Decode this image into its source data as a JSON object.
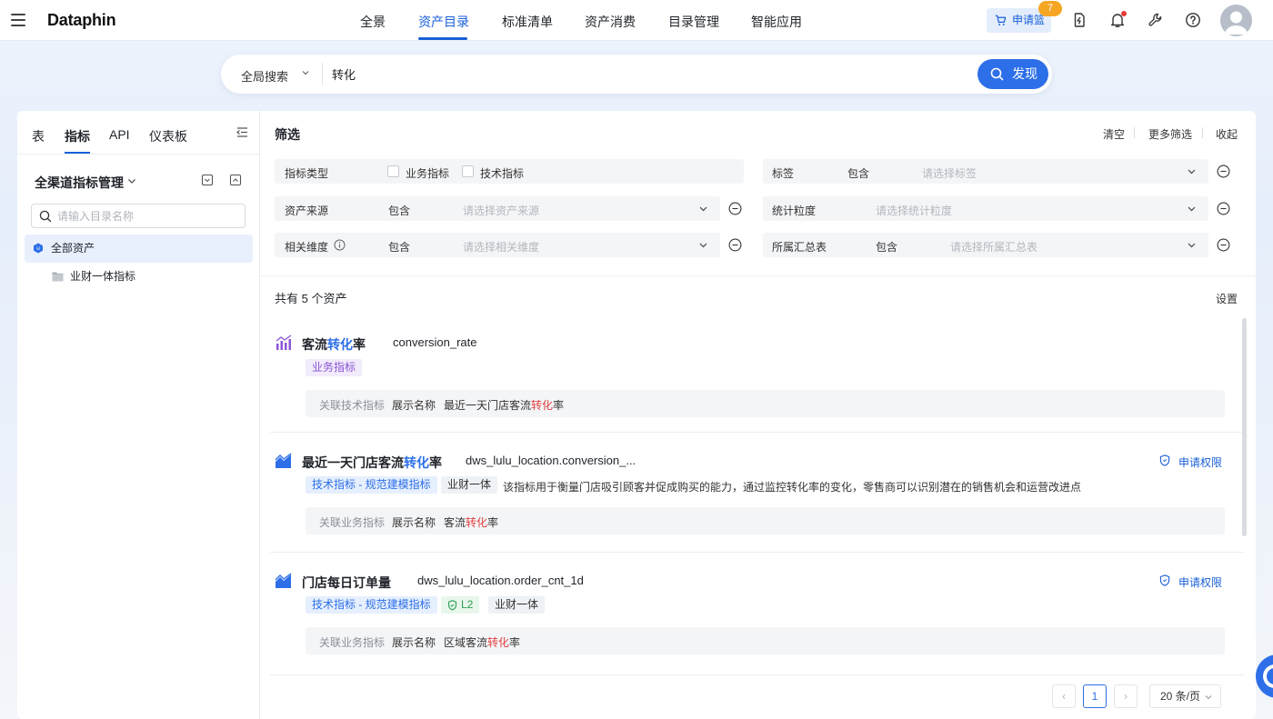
{
  "app": {
    "logo": "Dataphin"
  },
  "nav": {
    "items": [
      "全景",
      "资产目录",
      "标准清单",
      "资产消费",
      "目录管理",
      "智能应用"
    ],
    "active_index": 1
  },
  "header": {
    "cart_label": "申请篮",
    "cart_count": "7"
  },
  "search": {
    "scope": "全局搜索",
    "query": "转化",
    "button": "发现"
  },
  "left_panel": {
    "tabs": [
      "表",
      "指标",
      "API",
      "仪表板"
    ],
    "active_tab": 1,
    "tree_title": "全渠道指标管理",
    "dir_search_placeholder": "请输入目录名称",
    "tree": [
      {
        "label": "全部资产",
        "selected": true
      },
      {
        "label": "业财一体指标",
        "selected": false
      }
    ]
  },
  "filter": {
    "title": "筛选",
    "actions": [
      "清空",
      "更多筛选",
      "收起"
    ],
    "rows": {
      "metric_type": {
        "label": "指标类型",
        "options": [
          "业务指标",
          "技术指标"
        ]
      },
      "tag": {
        "label": "标签",
        "op": "包含",
        "placeholder": "请选择标签"
      },
      "asset_source": {
        "label": "资产来源",
        "op": "包含",
        "placeholder": "请选择资产来源"
      },
      "stat_granularity": {
        "label": "统计粒度",
        "placeholder": "请选择统计粒度"
      },
      "related_dimension": {
        "label": "相关维度",
        "op": "包含",
        "placeholder": "请选择相关维度"
      },
      "summary_table": {
        "label": "所属汇总表",
        "op": "包含",
        "placeholder": "请选择所属汇总表"
      }
    }
  },
  "results": {
    "count_text": "共有 5 个资产",
    "settings_label": "设置",
    "cards": [
      {
        "title_pre": "客流",
        "title_hl": "转化",
        "title_post": "率",
        "code": "conversion_rate",
        "tags": [
          "业务指标"
        ],
        "rel_key": "关联技术指标",
        "rel_label": "展示名称",
        "rel_pre": "最近一天门店客流",
        "rel_hl": "转化",
        "rel_post": "率"
      },
      {
        "title_pre": "最近一天门店客流",
        "title_hl": "转化",
        "title_post": "率",
        "code": "dws_lulu_location.conversion_...",
        "apply": "申请权限",
        "tags": [
          "技术指标 - 规范建模指标",
          "业财一体"
        ],
        "description": "该指标用于衡量门店吸引顾客并促成购买的能力，通过监控转化率的变化，零售商可以识别潜在的销售机会和运营改进点",
        "rel_key": "关联业务指标",
        "rel_label": "展示名称",
        "rel_pre": "客流",
        "rel_hl": "转化",
        "rel_post": "率"
      },
      {
        "title_pre": "门店每日订单量",
        "title_hl": "",
        "title_post": "",
        "code": "dws_lulu_location.order_cnt_1d",
        "apply": "申请权限",
        "tags": [
          "技术指标 - 规范建模指标",
          "L2",
          "业财一体"
        ],
        "rel_key": "关联业务指标",
        "rel_label": "展示名称",
        "rel_pre": "区域客流",
        "rel_hl": "转化",
        "rel_post": "率"
      }
    ]
  },
  "pagination": {
    "prev": "‹",
    "page": "1",
    "next": "›",
    "page_size": "20 条/页"
  },
  "colors": {
    "primary": "#2d6fe8",
    "highlight_red": "#e23d3d",
    "biz_tag": "#8b55d6",
    "cart_badge": "#f6a623"
  }
}
